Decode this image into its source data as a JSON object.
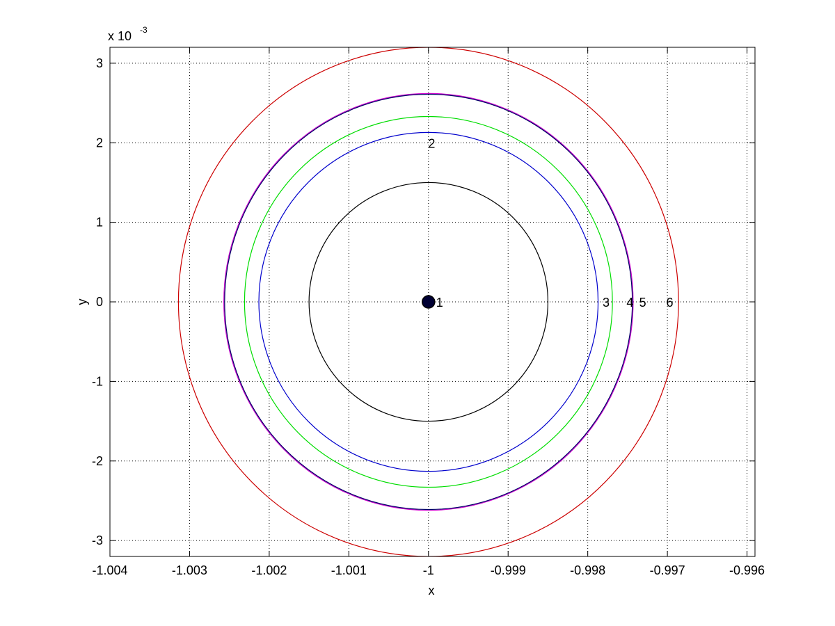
{
  "chart_data": {
    "type": "line",
    "title": "",
    "xlabel": "x",
    "ylabel": "y",
    "xlim": [
      -1.004,
      -0.9959
    ],
    "ylim": [
      -3.2,
      3.2
    ],
    "y_scale_note": "x 10",
    "y_scale_exponent": "-3",
    "grid": true,
    "x_ticks": [
      -1.004,
      -1.003,
      -1.002,
      -1.001,
      -1.0,
      -0.999,
      -0.998,
      -0.997,
      -0.996
    ],
    "x_tick_labels": [
      "-1.004",
      "-1.003",
      "-1.002",
      "-1.001",
      "-1",
      "-0.999",
      "-0.998",
      "-0.997",
      "-0.996"
    ],
    "y_ticks": [
      -3,
      -2,
      -1,
      0,
      1,
      2,
      3
    ],
    "y_tick_labels": [
      "-3",
      "-2",
      "-1",
      "0",
      "1",
      "2",
      "3"
    ],
    "center": {
      "x": -1.0,
      "y": 0,
      "color": "#000033"
    },
    "series": [
      {
        "label": "1",
        "color": "#000000",
        "cx": -1.0,
        "rx": 0.0015,
        "ry": 1.5,
        "label_x": -0.99986,
        "label_y": 0
      },
      {
        "label": "2",
        "color": "#0000cc",
        "cx": -1.0,
        "rx": 0.00213,
        "ry": 2.13,
        "label_x": -0.99996,
        "label_y": 2.0
      },
      {
        "label": "3",
        "color": "#00dd00",
        "cx": -1.0,
        "rx": 0.00231,
        "ry": 2.33,
        "label_x": -0.99777,
        "label_y": 0
      },
      {
        "label": "4",
        "color": "#cc00cc",
        "cx": -1.0,
        "rx": 0.00257,
        "ry": 2.62,
        "label_x": -0.99747,
        "label_y": 0
      },
      {
        "label": "5",
        "color": "#000066",
        "cx": -1.0,
        "rx": 0.00256,
        "ry": 2.61,
        "label_x": -0.99731,
        "label_y": 0
      },
      {
        "label": "6",
        "color": "#cc0000",
        "cx": -1.0,
        "rx": 0.00314,
        "ry": 3.2,
        "label_x": -0.99697,
        "label_y": 0
      }
    ]
  }
}
